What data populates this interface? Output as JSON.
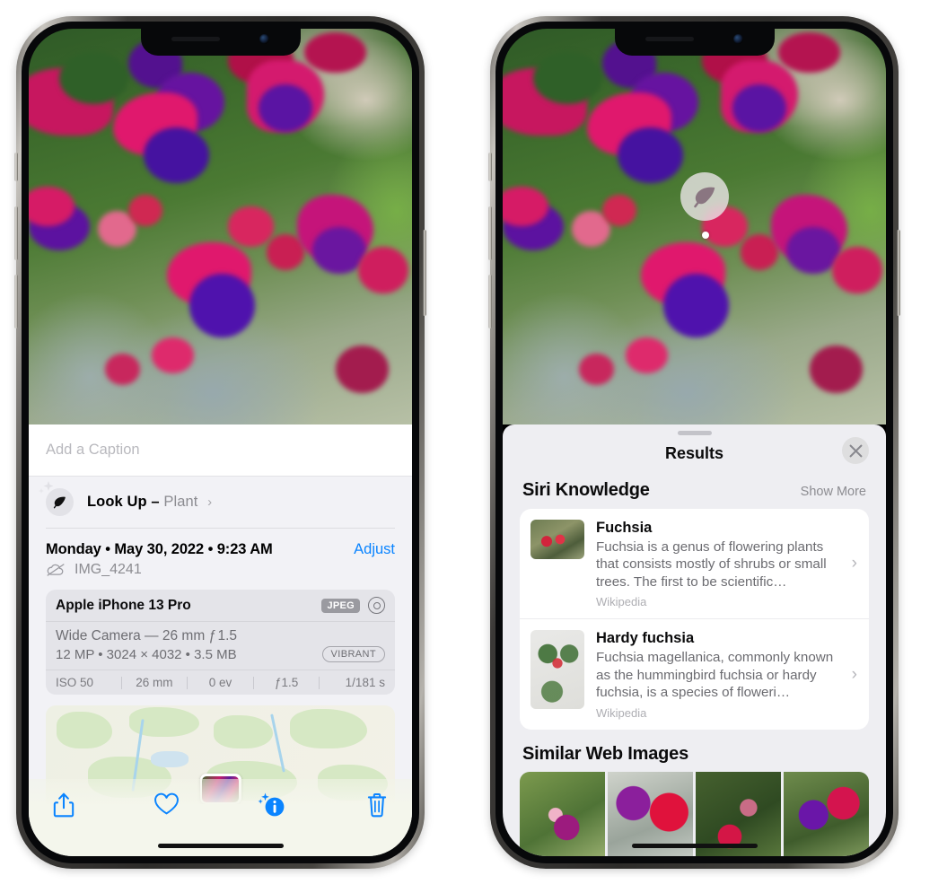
{
  "left_phone": {
    "photo": {
      "alt_name": "fuchsia-flowers-photo"
    },
    "caption": {
      "placeholder": "Add a Caption",
      "value": ""
    },
    "look_up": {
      "icon": "leaf-icon",
      "sparkle_icon": "sparkles-icon",
      "label": "Look Up –",
      "subject": "Plant",
      "chevron": "›"
    },
    "date_row": {
      "date_text": "Monday • May 30, 2022 • 9:23 AM",
      "adjust_label": "Adjust"
    },
    "file_row": {
      "icon": "cloud-slash-icon",
      "filename": "IMG_4241"
    },
    "exif": {
      "model": "Apple iPhone 13 Pro",
      "format_badge": "JPEG",
      "raw_icon": "raw-lens-icon",
      "lens_line": "Wide Camera — 26 mm ƒ 1.5",
      "size_line": "12 MP • 3024 × 4032 • 3.5 MB",
      "style_badge": "VIBRANT",
      "stats": [
        "ISO 50",
        "26 mm",
        "0 ev",
        "ƒ1.5",
        "1/181 s"
      ]
    },
    "map": {
      "name": "location-map",
      "pin_name": "photo-location-pin"
    },
    "toolbar": [
      {
        "name": "share-button",
        "icon": "share-icon"
      },
      {
        "name": "favorite-button",
        "icon": "heart-icon"
      },
      {
        "name": "info-button",
        "icon": "info-sparkle-icon"
      },
      {
        "name": "delete-button",
        "icon": "trash-icon"
      }
    ],
    "home_indicator": "home-indicator"
  },
  "right_phone": {
    "visual_look_up_badge": {
      "icon": "leaf-icon",
      "name": "visual-look-up-badge"
    },
    "sheet": {
      "grabber": "sheet-grabber",
      "title": "Results",
      "close_icon": "close-icon"
    },
    "siri_knowledge": {
      "title": "Siri Knowledge",
      "show_more": "Show More",
      "items": [
        {
          "title": "Fuchsia",
          "description": "Fuchsia is a genus of flowering plants that consists mostly of shrubs or small trees. The first to be scientific…",
          "source": "Wikipedia",
          "thumb": "fuchsia-thumbnail",
          "chevron": "›"
        },
        {
          "title": "Hardy fuchsia",
          "description": "Fuchsia magellanica, commonly known as the hummingbird fuchsia or hardy fuchsia, is a species of floweri…",
          "source": "Wikipedia",
          "thumb": "hardy-fuchsia-thumbnail",
          "chevron": "›"
        }
      ]
    },
    "similar_web_images": {
      "title": "Similar Web Images",
      "images": [
        "web-image-1",
        "web-image-2",
        "web-image-3",
        "web-image-4"
      ]
    },
    "home_indicator": "home-indicator"
  },
  "colors": {
    "accent_blue": "#0a84ff",
    "sheet_bg": "#eeeef2",
    "info_bg": "#f2f2f6",
    "card_bg": "#ffffff",
    "secondary_text": "#6b6b70",
    "tertiary_text": "#aeaeb3"
  }
}
